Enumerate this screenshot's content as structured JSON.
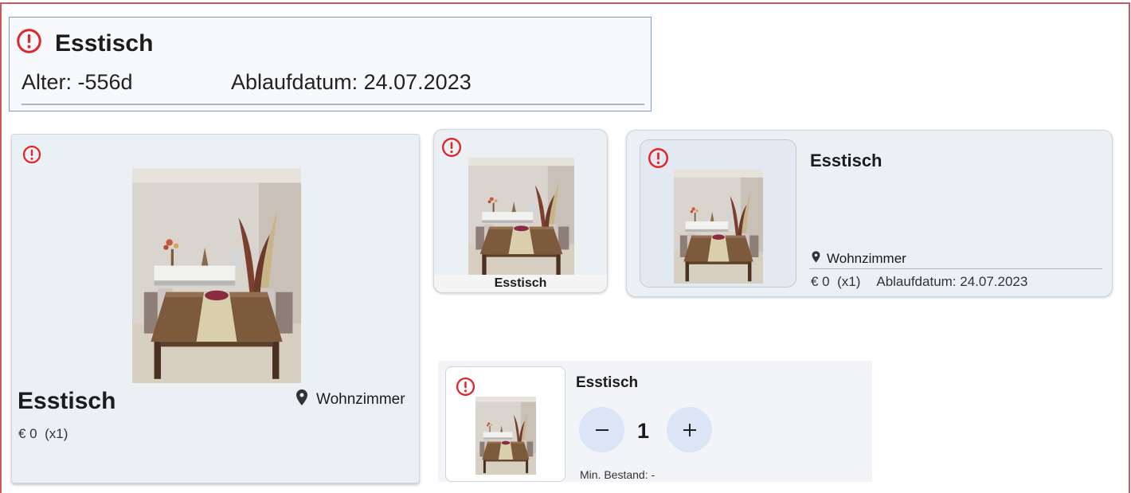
{
  "item": {
    "name": "Esstisch",
    "age": "Alter: -556d",
    "expiry": "Ablaufdatum: 24.07.2023",
    "location": "Wohnzimmer",
    "price": "€ 0",
    "quantity_suffix": "(x1)",
    "price_line": "€ 0  (x1)"
  },
  "stock": {
    "quantity": "1",
    "min_label": "Min. Bestand: -"
  },
  "icons": {
    "status": "alert-circle-icon",
    "location": "map-pin-icon",
    "decrement": "minus-icon",
    "increment": "plus-icon"
  },
  "colors": {
    "alert": "#e0242c",
    "card_background": "#ebf0f5",
    "stepper_button": "#dbe5f6",
    "frame_border": "#c85a5a",
    "summary_border": "#7f9cbb"
  }
}
